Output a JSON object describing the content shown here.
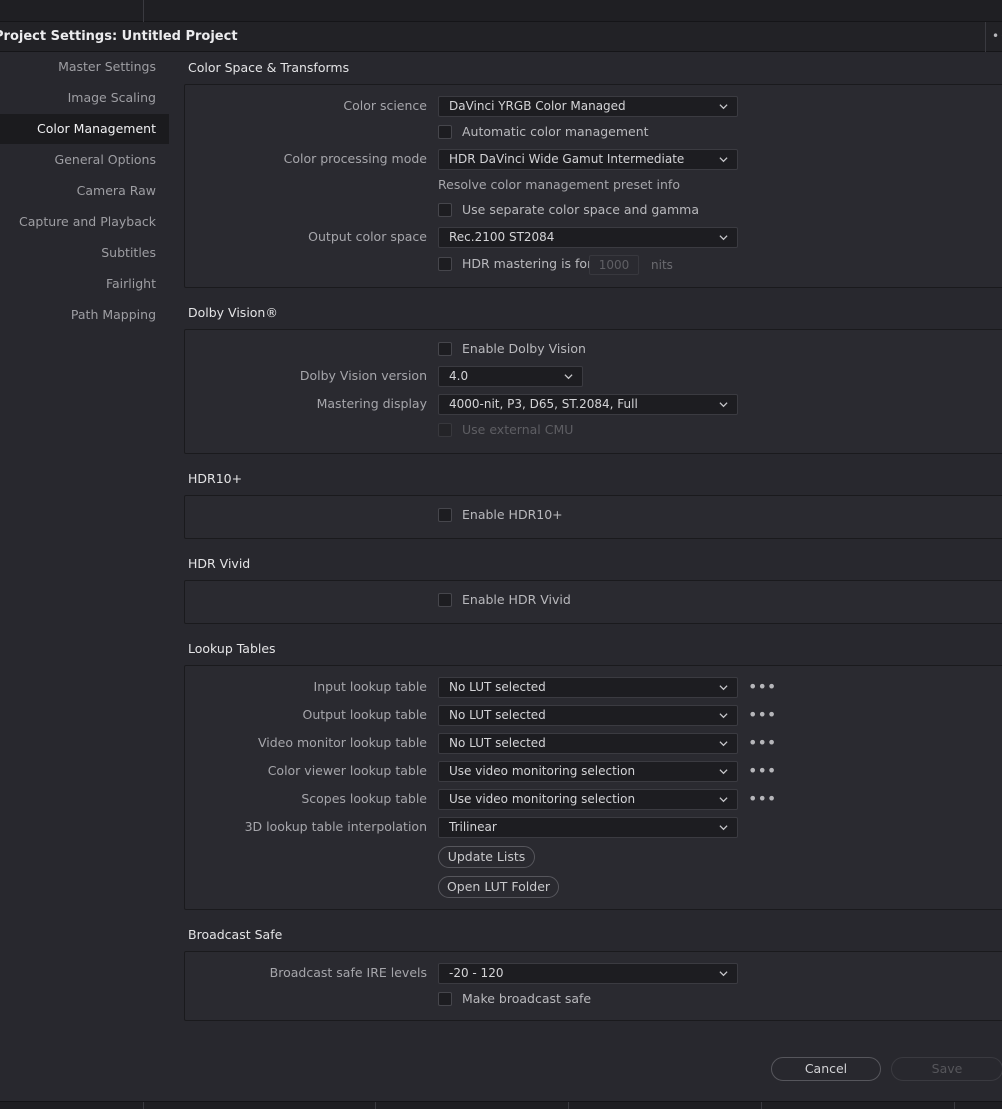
{
  "window": {
    "title": "Project Settings:  Untitled Project",
    "menu_dots": "•••"
  },
  "sidebar": {
    "items": [
      {
        "label": "Master Settings"
      },
      {
        "label": "Image Scaling"
      },
      {
        "label": "Color Management",
        "active": true
      },
      {
        "label": "General Options"
      },
      {
        "label": "Camera Raw"
      },
      {
        "label": "Capture and Playback"
      },
      {
        "label": "Subtitles"
      },
      {
        "label": "Fairlight"
      },
      {
        "label": "Path Mapping"
      }
    ]
  },
  "color_space": {
    "title": "Color Space & Transforms",
    "color_science_label": "Color science",
    "color_science_value": "DaVinci YRGB Color Managed",
    "auto_color_mgmt_label": "Automatic color management",
    "processing_mode_label": "Color processing mode",
    "processing_mode_value": "HDR DaVinci Wide Gamut Intermediate",
    "preset_info": "Resolve color management preset info",
    "separate_label": "Use separate color space and gamma",
    "output_label": "Output color space",
    "output_value": "Rec.2100 ST2084",
    "hdr_mastering_label": "HDR mastering is for",
    "hdr_mastering_value": "1000",
    "hdr_mastering_unit": "nits"
  },
  "dolby": {
    "title": "Dolby Vision®",
    "enable_label": "Enable Dolby Vision",
    "version_label": "Dolby Vision version",
    "version_value": "4.0",
    "mastering_label": "Mastering display",
    "mastering_value": "4000-nit, P3, D65, ST.2084, Full",
    "external_cmu_label": "Use external CMU"
  },
  "hdr10": {
    "title": "HDR10+",
    "enable_label": "Enable HDR10+"
  },
  "hdr_vivid": {
    "title": "HDR Vivid",
    "enable_label": "Enable HDR Vivid"
  },
  "lut": {
    "title": "Lookup Tables",
    "rows": [
      {
        "label": "Input lookup table",
        "value": "No LUT selected"
      },
      {
        "label": "Output lookup table",
        "value": "No LUT selected"
      },
      {
        "label": "Video monitor lookup table",
        "value": "No LUT selected"
      },
      {
        "label": "Color viewer lookup table",
        "value": "Use video monitoring selection"
      },
      {
        "label": "Scopes lookup table",
        "value": "Use video monitoring selection"
      }
    ],
    "more_dots": "•••",
    "interp_label": "3D lookup table interpolation",
    "interp_value": "Trilinear",
    "update_button": "Update Lists",
    "open_folder_button": "Open LUT Folder"
  },
  "broadcast": {
    "title": "Broadcast Safe",
    "ire_label": "Broadcast safe IRE levels",
    "ire_value": "-20 - 120",
    "make_safe_label": "Make broadcast safe"
  },
  "footer": {
    "cancel": "Cancel",
    "save": "Save"
  },
  "icons": {
    "dropdown": "chevron-down-icon",
    "more": "more-dots-icon"
  },
  "colors": {
    "background": "#28282e",
    "panel": "#2a2a30",
    "field": "#1d1d21",
    "active_sidebar": "#1b1b1e"
  }
}
